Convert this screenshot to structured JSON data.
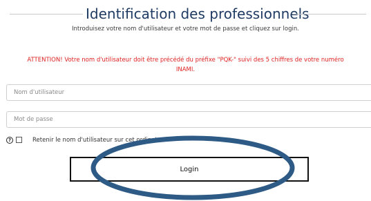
{
  "header": {
    "title": "Identification des professionnels",
    "subtitle": "Introduisez votre nom d'utilisateur et votre mot de passe et cliquez sur login."
  },
  "warning": {
    "text": "ATTENTION! Votre nom d'utilisateur doit être précédé du préfixe \"PQK-\" suivi des 5 chiffres de votre numéro INAMI.",
    "color": "#e02020"
  },
  "form": {
    "username_placeholder": "Nom d'utilisateur",
    "username_value": "",
    "password_placeholder": "Mot de passe",
    "password_value": "",
    "remember_label": "Retenir le nom d'utilisateur sur cet ordinateur",
    "remember_checked": false,
    "help_icon": "help-circle-icon",
    "login_label": "Login"
  },
  "annotation": {
    "shape": "ellipse",
    "color": "#2e5a86",
    "target": "login-button"
  },
  "colors": {
    "title": "#1f3b63",
    "warning": "#e02020",
    "button_border": "#111111"
  }
}
